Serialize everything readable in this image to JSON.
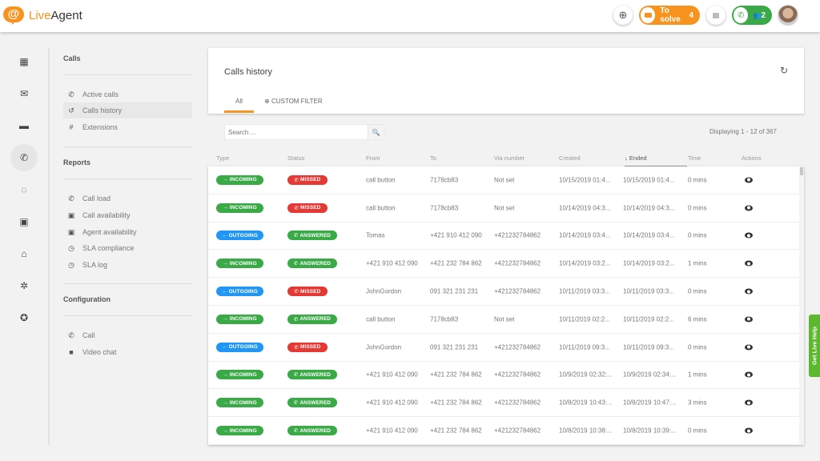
{
  "app": {
    "logo_prefix": "Live",
    "logo_suffix": "Agent"
  },
  "topbar": {
    "add_icon": "plus-circle-icon",
    "to_solve": {
      "label": "To solve",
      "count": "4"
    },
    "chat_icon": "chat-icon",
    "calls": {
      "agents_count": "2"
    }
  },
  "rail": [
    {
      "name": "dashboard",
      "glyph": "▦"
    },
    {
      "name": "tickets",
      "glyph": "✉"
    },
    {
      "name": "chats",
      "glyph": "▬"
    },
    {
      "name": "calls",
      "glyph": "✆",
      "active": true
    },
    {
      "name": "reports",
      "glyph": "◌"
    },
    {
      "name": "contacts",
      "glyph": "▣"
    },
    {
      "name": "knowledgebase",
      "glyph": "⌂"
    },
    {
      "name": "configuration",
      "glyph": "✲"
    },
    {
      "name": "plugins",
      "glyph": "✪"
    }
  ],
  "subnav": {
    "calls_title": "Calls",
    "calls_items": [
      {
        "label": "Active calls",
        "icon": "✆"
      },
      {
        "label": "Calls history",
        "icon": "↺",
        "active": true
      },
      {
        "label": "Extensions",
        "icon": "#"
      }
    ],
    "reports_title": "Reports",
    "reports_items": [
      {
        "label": "Call load",
        "icon": "✆"
      },
      {
        "label": "Call availability",
        "icon": "▣"
      },
      {
        "label": "Agent availability",
        "icon": "▣"
      },
      {
        "label": "SLA compliance",
        "icon": "◷"
      },
      {
        "label": "SLA log",
        "icon": "◷"
      }
    ],
    "config_title": "Configuration",
    "config_items": [
      {
        "label": "Call",
        "icon": "✆"
      },
      {
        "label": "Video chat",
        "icon": "■"
      }
    ]
  },
  "main": {
    "title": "Calls history",
    "tabs": {
      "all": "All",
      "custom_filter": "CUSTOM FILTER"
    },
    "search_placeholder": "Search ...",
    "displaying": "Displaying 1 - 12 of 367",
    "columns": [
      "Type",
      "Status",
      "From",
      "To",
      "Via number",
      "Created",
      "Ended",
      "Time",
      "Actions"
    ],
    "sorted_column": "Ended",
    "rows": [
      {
        "type": "INCOMING",
        "status": "MISSED",
        "from": "call button",
        "to": "7178cb83",
        "via": "Not set",
        "created": "10/15/2019 01:4...",
        "ended": "10/15/2019 01:4...",
        "time": "0 mins"
      },
      {
        "type": "INCOMING",
        "status": "MISSED",
        "from": "call button",
        "to": "7178cb83",
        "via": "Not set",
        "created": "10/14/2019 04:3...",
        "ended": "10/14/2019 04:3...",
        "time": "0 mins"
      },
      {
        "type": "OUTGOING",
        "status": "ANSWERED",
        "from": "Tomas",
        "to": "+421 910 412 090",
        "via": "+421232784862",
        "created": "10/14/2019 03:4...",
        "ended": "10/14/2019 03:4...",
        "time": "0 mins"
      },
      {
        "type": "INCOMING",
        "status": "ANSWERED",
        "from": "+421 910 412 090",
        "to": "+421 232 784 862",
        "via": "+421232784862",
        "created": "10/14/2019 03:2...",
        "ended": "10/14/2019 03:2...",
        "time": "1 mins"
      },
      {
        "type": "OUTGOING",
        "status": "MISSED",
        "from": "JohnGordon",
        "to": "091 321 231 231",
        "via": "+421232784862",
        "created": "10/11/2019 03:3...",
        "ended": "10/11/2019 03:3...",
        "time": "0 mins"
      },
      {
        "type": "INCOMING",
        "status": "ANSWERED",
        "from": "call button",
        "to": "7178cb83",
        "via": "Not set",
        "created": "10/11/2019 02:2...",
        "ended": "10/11/2019 02:2...",
        "time": "6 mins"
      },
      {
        "type": "OUTGOING",
        "status": "MISSED",
        "from": "JohnGordon",
        "to": "091 321 231 231",
        "via": "+421232784862",
        "created": "10/11/2019 09:3...",
        "ended": "10/11/2019 09:3...",
        "time": "0 mins"
      },
      {
        "type": "INCOMING",
        "status": "ANSWERED",
        "from": "+421 910 412 090",
        "to": "+421 232 784 862",
        "via": "+421232784862",
        "created": "10/9/2019 02:32:...",
        "ended": "10/9/2019 02:34:...",
        "time": "1 mins"
      },
      {
        "type": "INCOMING",
        "status": "ANSWERED",
        "from": "+421 910 412 090",
        "to": "+421 232 784 862",
        "via": "+421232784862",
        "created": "10/8/2019 10:43:...",
        "ended": "10/8/2019 10:47:...",
        "time": "3 mins"
      },
      {
        "type": "INCOMING",
        "status": "ANSWERED",
        "from": "+421 910 412 090",
        "to": "+421 232 784 862",
        "via": "+421232784862",
        "created": "10/8/2019 10:38:...",
        "ended": "10/8/2019 10:39:...",
        "time": "0 mins"
      }
    ]
  },
  "colors": {
    "brand_orange": "#f7931e",
    "incoming": "#3aaa47",
    "outgoing": "#2196f3",
    "missed": "#e53935",
    "answered": "#3aaa47",
    "live_help": "#5cb82c"
  },
  "live_help": "Get Live Help"
}
